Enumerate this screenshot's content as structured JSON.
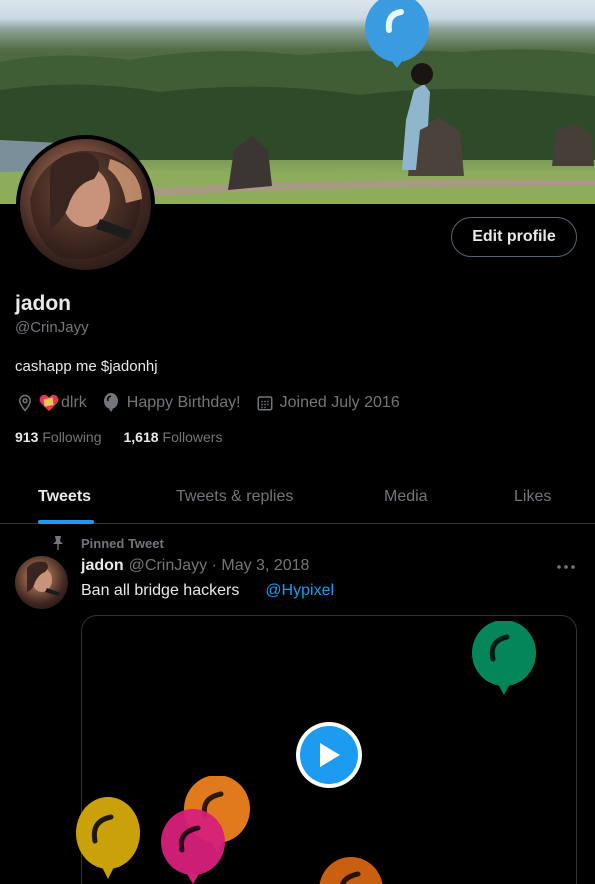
{
  "profile": {
    "name": "jadon",
    "handle": "@CrinJayy",
    "bio": "cashapp me $jadonhj",
    "location": "dlrk",
    "birthday": "Happy Birthday!",
    "joined": "Joined July 2016",
    "following_count": "913",
    "following_label": "Following",
    "followers_count": "1,618",
    "followers_label": "Followers",
    "edit_label": "Edit profile"
  },
  "tabs": [
    {
      "label": "Tweets",
      "active": true
    },
    {
      "label": "Tweets & replies",
      "active": false
    },
    {
      "label": "Media",
      "active": false
    },
    {
      "label": "Likes",
      "active": false
    }
  ],
  "pinned_tweet": {
    "pinned_label": "Pinned Tweet",
    "name": "jadon",
    "meta": "@CrinJayy · May 3, 2018",
    "text": "Ban all bridge hackers",
    "mention": "@Hypixel"
  },
  "colors": {
    "accent": "#1d9bf0",
    "balloon_blue": "#3a9be0",
    "balloon_green": "#05865a",
    "balloon_orange": "#e07a1c",
    "balloon_yellow": "#c9a20a",
    "balloon_pink": "#d6207a"
  },
  "icons": [
    "location-icon",
    "balloon-icon",
    "calendar-icon",
    "pin-icon",
    "more-icon",
    "play-icon"
  ]
}
